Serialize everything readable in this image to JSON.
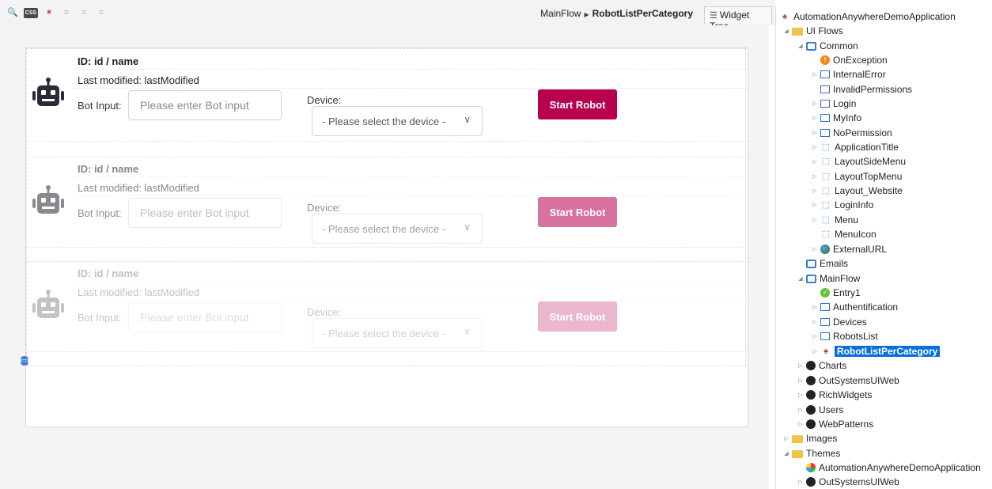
{
  "toolbar": {
    "icons": [
      "preview-icon",
      "css-icon",
      "style-paint-icon",
      "align-left-icon",
      "align-center-icon",
      "align-right-icon"
    ],
    "css_text": "CSS"
  },
  "breadcrumb": {
    "parent": "MainFlow",
    "current": "RobotListPerCategory"
  },
  "widget_tree_tab": {
    "label": "Widget Tree"
  },
  "robot_items": [
    {
      "id_label": "ID: id / name",
      "modified_label": "Last modified: lastModified",
      "bot_input_label": "Bot Input:",
      "bot_input_placeholder": "Please enter Bot input",
      "device_label": "Device:",
      "device_select_value": "- Please select the device -",
      "start_button_label": "Start Robot"
    },
    {
      "id_label": "ID: id / name",
      "modified_label": "Last modified: lastModified",
      "bot_input_label": "Bot Input:",
      "bot_input_placeholder": "Please enter Bot input",
      "device_label": "Device:",
      "device_select_value": "- Please select the device -",
      "start_button_label": "Start Robot"
    },
    {
      "id_label": "ID: id / name",
      "modified_label": "Last modified: lastModified",
      "bot_input_label": "Bot Input:",
      "bot_input_placeholder": "Please enter Bot input",
      "device_label": "Device:",
      "device_select_value": "- Please select the device -",
      "start_button_label": "Start Robot"
    }
  ],
  "colors": {
    "accent": "#b9004f",
    "selection": "#0a6fde"
  },
  "tree": {
    "root": "AutomationAnywhereDemoApplication",
    "ui_flows": "UI Flows",
    "common": "Common",
    "on_exception": "OnException",
    "internal_error": "InternalError",
    "invalid_permissions": "InvalidPermissions",
    "login": "Login",
    "my_info": "MyInfo",
    "no_permission": "NoPermission",
    "application_title": "ApplicationTitle",
    "layout_side_menu": "LayoutSideMenu",
    "layout_top_menu": "LayoutTopMenu",
    "layout_website": "Layout_Website",
    "login_info": "LoginInfo",
    "menu": "Menu",
    "menu_icon": "MenuIcon",
    "external_url": "ExternalURL",
    "emails": "Emails",
    "main_flow": "MainFlow",
    "entry1": "Entry1",
    "authentification": "Authentification",
    "devices": "Devices",
    "robots_list": "RobotsList",
    "robot_list_per_category": "RobotListPerCategory",
    "charts": "Charts",
    "outsystems_ui_web": "OutSystemsUIWeb",
    "rich_widgets": "RichWidgets",
    "users": "Users",
    "web_patterns": "WebPatterns",
    "images": "Images",
    "themes": "Themes",
    "theme_app": "AutomationAnywhereDemoApplication",
    "theme_outsystems": "OutSystemsUIWeb"
  }
}
